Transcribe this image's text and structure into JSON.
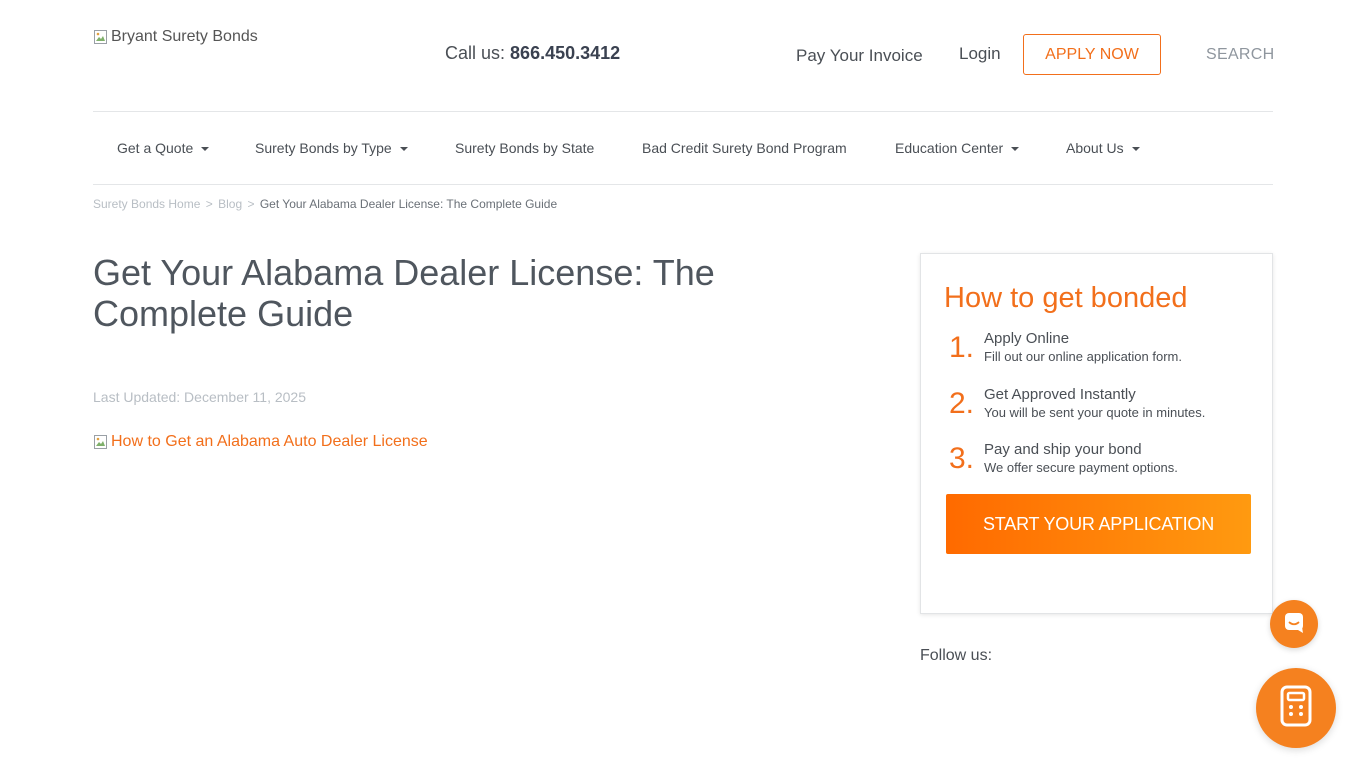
{
  "header": {
    "logo_alt": "Bryant Surety Bonds",
    "call_label": "Call us:",
    "phone": "866.450.3412",
    "pay_invoice": "Pay Your Invoice",
    "login": "Login",
    "apply_now": "APPLY NOW",
    "search": "SEARCH"
  },
  "nav": {
    "items": [
      {
        "label": "Get a Quote",
        "dropdown": true
      },
      {
        "label": "Surety Bonds by Type",
        "dropdown": true
      },
      {
        "label": "Surety Bonds by State",
        "dropdown": false
      },
      {
        "label": "Bad Credit Surety Bond Program",
        "dropdown": false
      },
      {
        "label": "Education Center",
        "dropdown": true
      },
      {
        "label": "About Us",
        "dropdown": true
      }
    ]
  },
  "breadcrumb": {
    "home": "Surety Bonds Home",
    "blog": "Blog",
    "separator": ">",
    "current": "Get Your Alabama Dealer License: The Complete Guide"
  },
  "article": {
    "title": "Get Your Alabama Dealer License: The Complete Guide",
    "last_updated": "Last Updated: December 11, 2025",
    "image_alt": "How to Get an Alabama Auto Dealer License"
  },
  "sidebar": {
    "title": "How to get bonded",
    "steps": [
      {
        "num": "1.",
        "title": "Apply Online",
        "desc": "Fill out our online application form."
      },
      {
        "num": "2.",
        "title": "Get Approved Instantly",
        "desc": "You will be sent your quote in minutes."
      },
      {
        "num": "3.",
        "title": "Pay and ship your bond",
        "desc": "We offer secure payment options."
      }
    ],
    "cta": "START YOUR APPLICATION",
    "follow": "Follow us:"
  },
  "widgets": {
    "chat_icon": "chat-bubble-icon",
    "calculator_icon": "calculator-icon"
  },
  "colors": {
    "accent": "#f26f1b",
    "text": "#4a4f55",
    "muted": "#b8bec4"
  }
}
